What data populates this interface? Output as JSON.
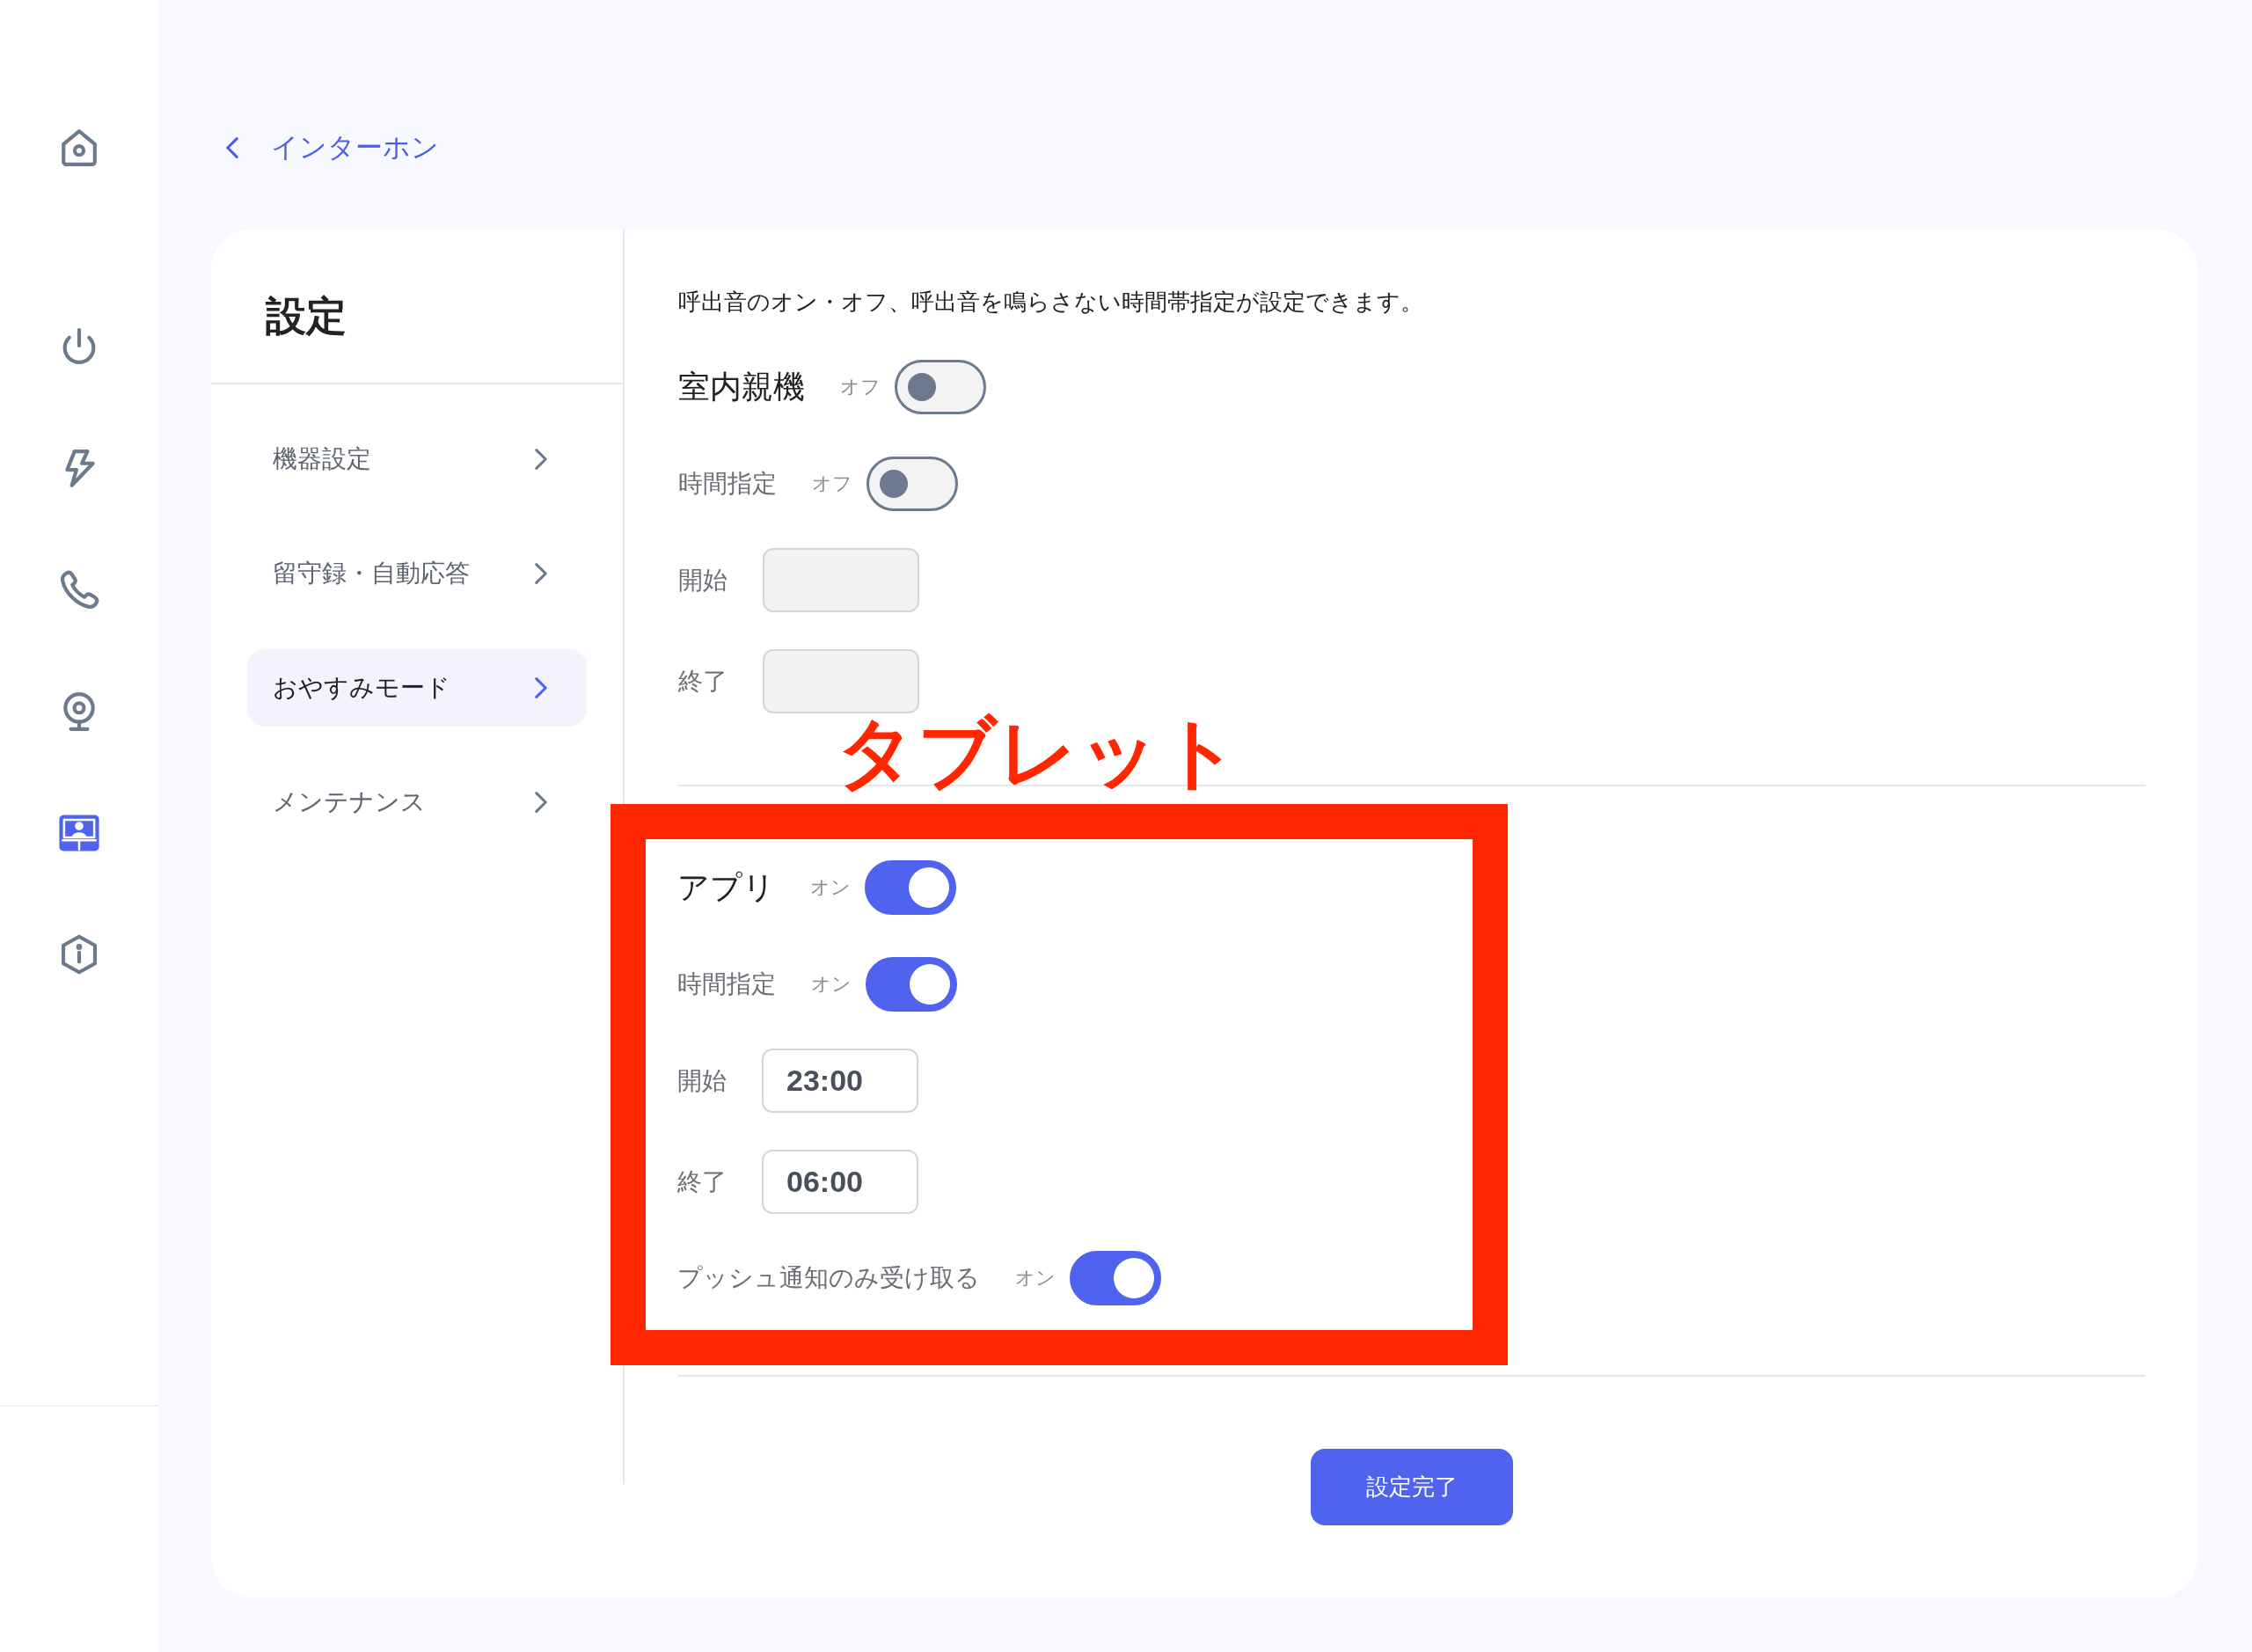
{
  "sidebar": {
    "items": [
      {
        "selected": false
      },
      {
        "selected": false
      },
      {
        "selected": false
      },
      {
        "selected": false
      },
      {
        "selected": false
      },
      {
        "selected": true
      },
      {
        "selected": false
      }
    ]
  },
  "back_link": {
    "label": "インターホン"
  },
  "settings_nav": {
    "title": "設定",
    "items": [
      {
        "label": "機器設定",
        "selected": false
      },
      {
        "label": "留守録・自動応答",
        "selected": false
      },
      {
        "label": "おやすみモード",
        "selected": true
      },
      {
        "label": "メンテナンス",
        "selected": false
      }
    ]
  },
  "description": "呼出音のオン・オフ、呼出音を鳴らさない時間帯指定が設定できます。",
  "sections": [
    {
      "title": "室内親機",
      "state_label": "オフ",
      "on": false,
      "rows": [
        {
          "kind": "toggle",
          "label": "時間指定",
          "state_label": "オフ",
          "on": false
        },
        {
          "kind": "time",
          "label": "開始",
          "disabled": true
        },
        {
          "kind": "time",
          "label": "終了",
          "disabled": true
        }
      ]
    },
    {
      "title": "アプリ",
      "state_label": "オン",
      "on": true,
      "highlight": {
        "label": "タブレット"
      },
      "rows": [
        {
          "kind": "toggle",
          "label": "時間指定",
          "state_label": "オン",
          "on": true
        },
        {
          "kind": "time",
          "label": "開始",
          "value": "23:00",
          "disabled": false
        },
        {
          "kind": "time",
          "label": "終了",
          "value": "06:00",
          "disabled": false
        },
        {
          "kind": "toggle",
          "label": "プッシュ通知のみ受け取る",
          "state_label": "オン",
          "on": true
        }
      ]
    }
  ],
  "submit_button": {
    "label": "設定完了"
  }
}
